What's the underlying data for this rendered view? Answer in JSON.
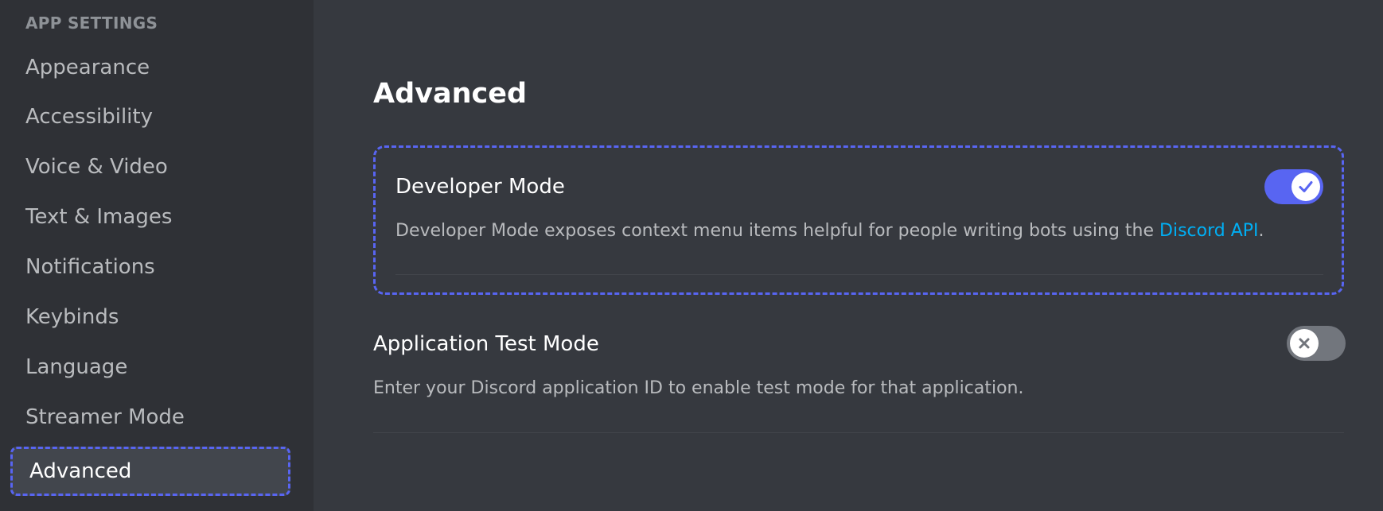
{
  "sidebar": {
    "header": "APP SETTINGS",
    "items": [
      {
        "label": "Appearance"
      },
      {
        "label": "Accessibility"
      },
      {
        "label": "Voice & Video"
      },
      {
        "label": "Text & Images"
      },
      {
        "label": "Notifications"
      },
      {
        "label": "Keybinds"
      },
      {
        "label": "Language"
      },
      {
        "label": "Streamer Mode"
      },
      {
        "label": "Advanced",
        "selected": true
      }
    ]
  },
  "main": {
    "title": "Advanced",
    "settings": [
      {
        "title": "Developer Mode",
        "description": "Developer Mode exposes context menu items helpful for people writing bots using the ",
        "link_text": "Discord API",
        "description_suffix": ".",
        "enabled": true,
        "toggle_icon": "check-icon"
      },
      {
        "title": "Application Test Mode",
        "description": "Enter your Discord application ID to enable test mode for that application.",
        "enabled": false,
        "toggle_icon": "x-icon"
      }
    ]
  },
  "colors": {
    "accent": "#5865f2",
    "link": "#00aff4",
    "sidebar_bg": "#2f3136",
    "main_bg": "#36393f",
    "toggle_off": "#72767d"
  }
}
